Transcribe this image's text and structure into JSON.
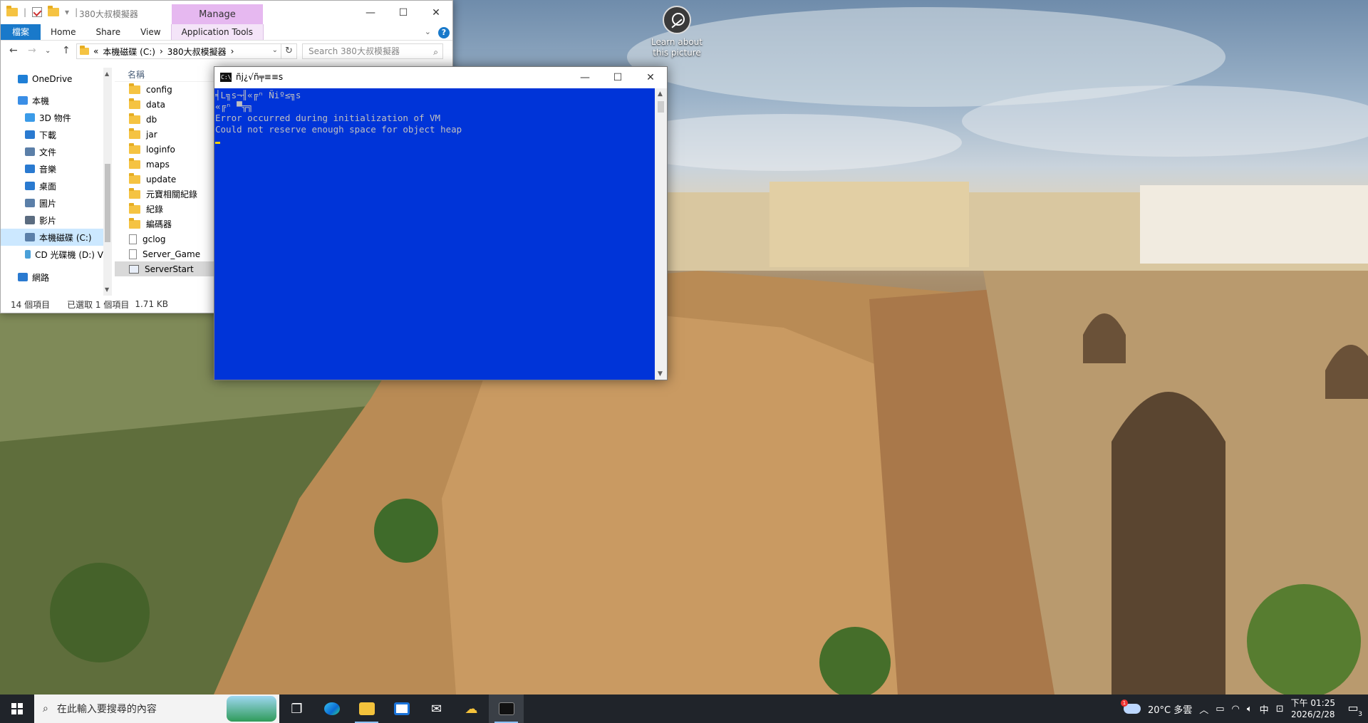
{
  "desktop": {
    "icon_label": "Learn about this picture"
  },
  "explorer": {
    "title": "380大叔模擬器",
    "manage_label": "Manage",
    "ribbon_tabs": [
      "檔案",
      "Home",
      "Share",
      "View",
      "Application Tools"
    ],
    "address": {
      "prefix": "«",
      "drive": "本機磁碟 (C:)",
      "folder": "380大叔模擬器",
      "sep": "›"
    },
    "search_placeholder": "Search 380大叔模擬器",
    "nav_items": [
      {
        "label": "OneDrive",
        "icon": "onedrive-icon",
        "color": "#1f7fd6"
      },
      {
        "label": "本機",
        "icon": "computer-icon",
        "color": "#3a8ee6"
      },
      {
        "label": "3D 物件",
        "icon": "cube-icon",
        "color": "#3b9be8"
      },
      {
        "label": "下載",
        "icon": "download-icon",
        "color": "#2a7ad0"
      },
      {
        "label": "文件",
        "icon": "document-icon",
        "color": "#5b7fa8"
      },
      {
        "label": "音樂",
        "icon": "music-icon",
        "color": "#2a7ad0"
      },
      {
        "label": "桌面",
        "icon": "desktop-icon",
        "color": "#2a7ad0"
      },
      {
        "label": "圖片",
        "icon": "pictures-icon",
        "color": "#5b7fa8"
      },
      {
        "label": "影片",
        "icon": "video-icon",
        "color": "#5b6c80"
      },
      {
        "label": "本機磁碟 (C:)",
        "icon": "drive-icon",
        "color": "#5b7fa8"
      },
      {
        "label": "CD 光碟機 (D:) V",
        "icon": "cd-drive-icon",
        "color": "#4aa0d8"
      },
      {
        "label": "網路",
        "icon": "network-icon",
        "color": "#2a7ad0"
      }
    ],
    "column_header": "名稱",
    "files": [
      {
        "name": "config",
        "type": "folder"
      },
      {
        "name": "data",
        "type": "folder"
      },
      {
        "name": "db",
        "type": "folder"
      },
      {
        "name": "jar",
        "type": "folder"
      },
      {
        "name": "loginfo",
        "type": "folder"
      },
      {
        "name": "maps",
        "type": "folder"
      },
      {
        "name": "update",
        "type": "folder"
      },
      {
        "name": "元寶相關紀錄",
        "type": "folder"
      },
      {
        "name": "紀錄",
        "type": "folder"
      },
      {
        "name": "編碼器",
        "type": "folder"
      },
      {
        "name": "gclog",
        "type": "file"
      },
      {
        "name": "Server_Game",
        "type": "file"
      },
      {
        "name": "ServerStart",
        "type": "batch"
      }
    ],
    "status": {
      "count": "14 個項目",
      "selected": "已選取 1 個項目",
      "size": "1.71 KB"
    }
  },
  "console": {
    "title": "ñj¿√ñ╤≡≡s",
    "lines": [
      "╡L╗s¬╢«╔ⁿ Ñiº≤╗s",
      "«╔ⁿ ▀╦╗",
      "Error occurred during initialization of VM",
      "Could not reserve enough space for object heap"
    ]
  },
  "taskbar": {
    "search_placeholder": "在此輸入要搜尋的內容",
    "weather": "20°C 多雲",
    "ime": "中",
    "time": "下午 01:25",
    "date": "2026/2/28",
    "notification_count": "3",
    "weather_badge": "1"
  }
}
